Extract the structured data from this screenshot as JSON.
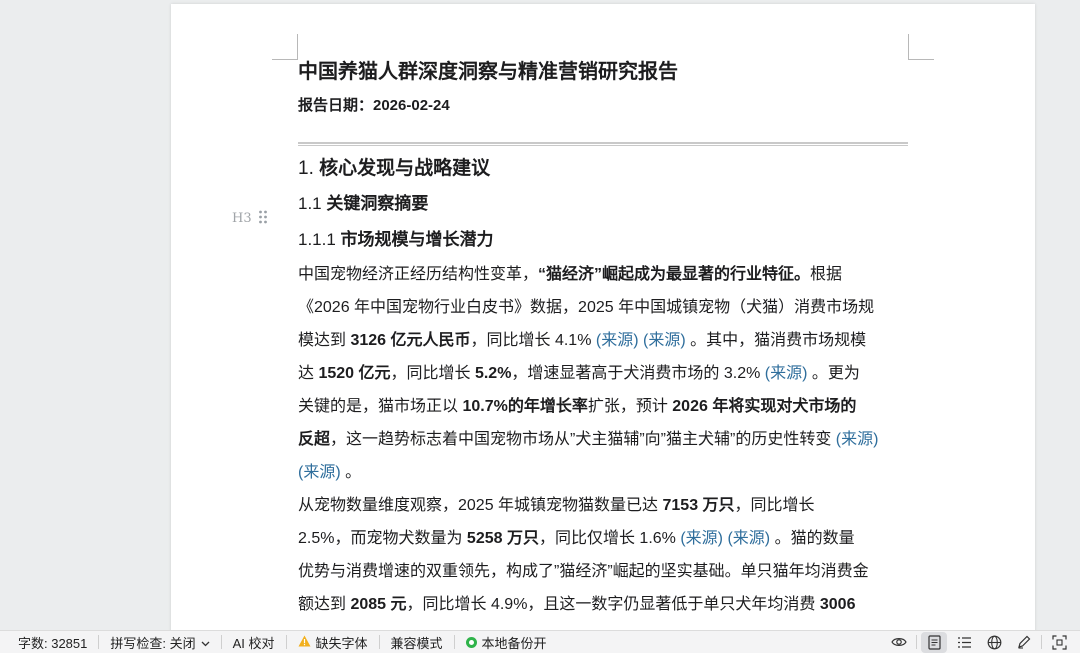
{
  "document": {
    "title": "中国养猫人群深度洞察与精准营销研究报告",
    "date_line": "报告日期：2026-02-24",
    "h1": {
      "num": "1.",
      "text": "核心发现与战略建议"
    },
    "h2": {
      "num": "1.1",
      "text": "关键洞察摘要"
    },
    "h3": {
      "num": "1.1.1",
      "text": "市场规模与增长潜力"
    },
    "heading_marker": "H3",
    "para1": {
      "l1": [
        "中国宠物经济正经历结构性变革，",
        "“猫经济”崛起成为最显著的行业特征。",
        "根据"
      ],
      "l2": [
        "《2026 年中国宠物行业白皮书》数据，2025 年中国城镇宠物（犬猫）消费市场规"
      ],
      "l3": [
        "模达到 ",
        "3126 亿元人民币",
        "，同比增长 4.1% ",
        "(来源)",
        " ",
        "(来源)",
        " 。其中，猫消费市场规模"
      ],
      "l4": [
        "达 ",
        "1520 亿元",
        "，同比增长 ",
        "5.2%",
        "，增速显著高于犬消费市场的 3.2% ",
        "(来源)",
        " 。更为"
      ],
      "l5": [
        "关键的是，猫市场正以 ",
        "10.7%的年增长率",
        "扩张，预计 ",
        "2026 年将实现对犬市场的"
      ],
      "l6": [
        "反超",
        "，这一趋势标志着中国宠物市场从”犬主猫辅”向”猫主犬辅”的历史性转变 ",
        "(来源)"
      ],
      "l7": [
        "(来源)",
        " 。"
      ]
    },
    "para2": {
      "l1": [
        "从宠物数量维度观察，2025 年城镇宠物猫数量已达 ",
        "7153 万只",
        "，同比增长"
      ],
      "l2": [
        "2.5%，而宠物犬数量为 ",
        "5258 万只",
        "，同比仅增长 1.6% ",
        "(来源)",
        " ",
        "(来源)",
        " 。猫的数量"
      ],
      "l3": [
        "优势与消费增速的双重领先，构成了”猫经济”崛起的坚实基础。单只猫年均消费金"
      ],
      "l4": [
        "额达到 ",
        "2085 元",
        "，同比增长 4.9%，且这一数字仍显著低于单只犬年均消费 ",
        "3006"
      ]
    }
  },
  "statusbar": {
    "word_count": "字数: 32851",
    "spell_check": "拼写检查: 关闭",
    "ai_proofread": "AI 校对",
    "missing_fonts": "缺失字体",
    "compat_mode": "兼容模式",
    "local_backup": "本地备份开"
  },
  "icons": [
    "eye-icon",
    "page-view-icon",
    "outline-view-icon",
    "web-view-icon",
    "pen-icon",
    "focus-mode-icon",
    "warning-icon",
    "drag-handle-icon",
    "chevron-down-icon"
  ],
  "colors": {
    "link": "#2f6e9c",
    "backup_ok": "#2fb34a",
    "warning": "#e6a000"
  }
}
